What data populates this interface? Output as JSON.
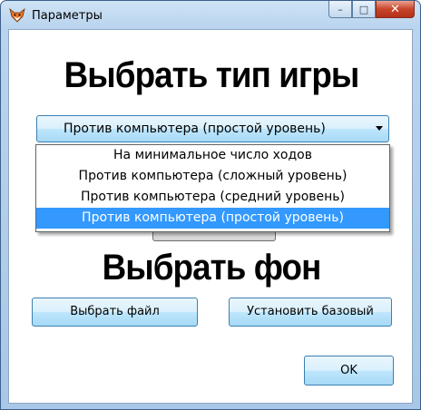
{
  "window": {
    "title": "Параметры",
    "minimize_label": "–",
    "maximize_label": "□",
    "close_label": "✕"
  },
  "game_type": {
    "heading": "Выбрать тип игры",
    "selected_value": "Против компьютера (простой уровень)",
    "options": [
      "На минимальное число ходов",
      "Против компьютера (сложный уровень)",
      "Против компьютера (средний уровень)",
      "Против компьютера (простой уровень)"
    ],
    "highlighted_index": 3
  },
  "background": {
    "heading": "Выбрать фон",
    "choose_file_label": "Выбрать файл",
    "set_default_label": "Установить базовый"
  },
  "ok_label": "OK",
  "colors": {
    "selection": "#3399ff",
    "button_border": "#3c7fb1",
    "close_button": "#c8452b"
  }
}
